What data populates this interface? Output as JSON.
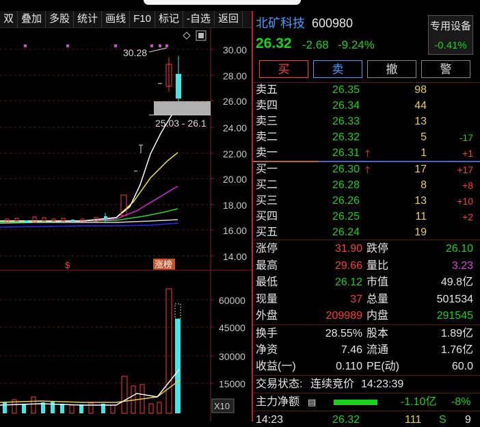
{
  "toolbar": {
    "items": [
      "双",
      "叠加",
      "多股",
      "统计",
      "画线",
      "F10",
      "标记",
      "-自选",
      "返回"
    ]
  },
  "chart": {
    "yticks": [
      "30.00",
      "28.00",
      "26.00",
      "24.00",
      "22.00",
      "20.00",
      "18.00",
      "16.00",
      "14.00"
    ],
    "high_label": "30.28",
    "range_label": "25.03 - 26.1",
    "limit_tag": "涨榜",
    "dollar_mark": "$",
    "vol_ticks": [
      "60000",
      "45000",
      "30000",
      "15000"
    ],
    "vol_unit": "X10"
  },
  "stock": {
    "name": "北矿科技",
    "code": "600980",
    "price": "26.32",
    "change": "-2.68",
    "pct": "-9.24%",
    "device_label": "专用设备",
    "device_pct": "-0.41%"
  },
  "buttons": {
    "buy": "买",
    "sell": "卖",
    "cancel": "撤",
    "alert": "警"
  },
  "sell_orders": [
    {
      "label": "卖五",
      "price": "26.35",
      "vol": "98",
      "chg": "",
      "arrow": false
    },
    {
      "label": "卖四",
      "price": "26.34",
      "vol": "44",
      "chg": "",
      "arrow": false
    },
    {
      "label": "卖三",
      "price": "26.33",
      "vol": "13",
      "chg": "",
      "arrow": false
    },
    {
      "label": "卖二",
      "price": "26.32",
      "vol": "5",
      "chg": "-17",
      "arrow": false
    },
    {
      "label": "卖一",
      "price": "26.31",
      "vol": "1",
      "chg": "+1",
      "arrow": true
    }
  ],
  "buy_orders": [
    {
      "label": "买一",
      "price": "26.30",
      "vol": "17",
      "chg": "+17",
      "arrow": true
    },
    {
      "label": "买二",
      "price": "26.28",
      "vol": "8",
      "chg": "+8",
      "arrow": false
    },
    {
      "label": "买三",
      "price": "26.26",
      "vol": "13",
      "chg": "+10",
      "arrow": false
    },
    {
      "label": "买四",
      "price": "26.25",
      "vol": "11",
      "chg": "+2",
      "arrow": false
    },
    {
      "label": "买五",
      "price": "26.24",
      "vol": "19",
      "chg": "",
      "arrow": false
    }
  ],
  "stats1": [
    {
      "l1": "涨停",
      "v1": "31.90",
      "l2": "跌停",
      "v2": "26.10"
    },
    {
      "l1": "最高",
      "v1": "29.66",
      "l2": "量比",
      "v2": "3.23"
    },
    {
      "l1": "最低",
      "v1": "26.12",
      "l2": "市值",
      "v2": "49.8亿"
    },
    {
      "l1": "现量",
      "v1": "37",
      "l2": "总量",
      "v2": "501534"
    },
    {
      "l1": "外盘",
      "v1": "209989",
      "l2": "内盘",
      "v2": "291545"
    }
  ],
  "stats2": [
    {
      "l1": "换手",
      "v1": "28.55%",
      "l2": "股本",
      "v2": "1.89亿"
    },
    {
      "l1": "净资",
      "v1": "7.46",
      "l2": "流通",
      "v2": "1.76亿"
    },
    {
      "l1": "收益(一)",
      "v1": "0.110",
      "l2": "PE(动)",
      "v2": "60.0"
    }
  ],
  "status": {
    "label": "交易状态:",
    "state": "连续竞价",
    "time": "14:23:39"
  },
  "capital": {
    "label": "主力净额",
    "value": "-1.10亿",
    "pct": "-8%",
    "bar_fraction": 0.8
  },
  "last_tick": {
    "time": "14:23",
    "price": "26.32",
    "vol": "111",
    "side": "S",
    "count": "9"
  },
  "colors": {
    "up": "#ff3b3b",
    "down": "#19d219",
    "volume_cyan": "#40e8e8"
  }
}
